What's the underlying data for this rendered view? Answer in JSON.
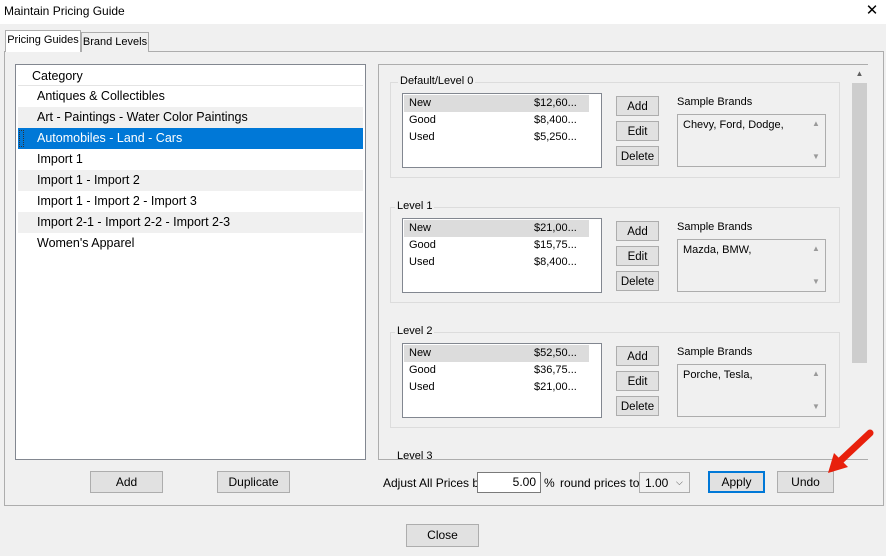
{
  "window": {
    "title": "Maintain Pricing Guide",
    "close_glyph": "✕"
  },
  "tabs": [
    {
      "label": "Pricing Guides"
    },
    {
      "label": "Brand Levels"
    }
  ],
  "category_list": {
    "header": "Category",
    "items": [
      "Antiques & Collectibles",
      "Art - Paintings - Water Color Paintings",
      "Automobiles - Land - Cars",
      "Import 1",
      "Import 1 - Import 2",
      "Import 1 - Import 2 - Import 3",
      "Import 2-1 - Import 2-2 - Import 2-3",
      "Women's Apparel"
    ],
    "selected": "Automobiles - Land - Cars"
  },
  "levels": [
    {
      "title": "Default/Level 0",
      "prices": [
        {
          "cond": "New",
          "price": "$12,60..."
        },
        {
          "cond": "Good",
          "price": "$8,400..."
        },
        {
          "cond": "Used",
          "price": "$5,250..."
        }
      ],
      "brands": "Chevy, Ford, Dodge,"
    },
    {
      "title": "Level 1",
      "prices": [
        {
          "cond": "New",
          "price": "$21,00..."
        },
        {
          "cond": "Good",
          "price": "$15,75..."
        },
        {
          "cond": "Used",
          "price": "$8,400..."
        }
      ],
      "brands": "Mazda, BMW,"
    },
    {
      "title": "Level 2",
      "prices": [
        {
          "cond": "New",
          "price": "$52,50..."
        },
        {
          "cond": "Good",
          "price": "$36,75..."
        },
        {
          "cond": "Used",
          "price": "$21,00..."
        }
      ],
      "brands": "Porche, Tesla,"
    },
    {
      "title": "Level 3"
    }
  ],
  "level_buttons": {
    "add": "Add",
    "edit": "Edit",
    "delete": "Delete",
    "sample_brands_label": "Sample Brands"
  },
  "bottom_left": {
    "add": "Add",
    "duplicate": "Duplicate"
  },
  "adjust": {
    "label": "Adjust All Prices by",
    "value": "5.00",
    "percent": "%",
    "round_label": "round prices to",
    "round_value": "1.00",
    "apply": "Apply",
    "undo": "Undo"
  },
  "footer": {
    "close": "Close"
  },
  "colors": {
    "selection": "#0078d7",
    "arrow": "#e8200c"
  }
}
